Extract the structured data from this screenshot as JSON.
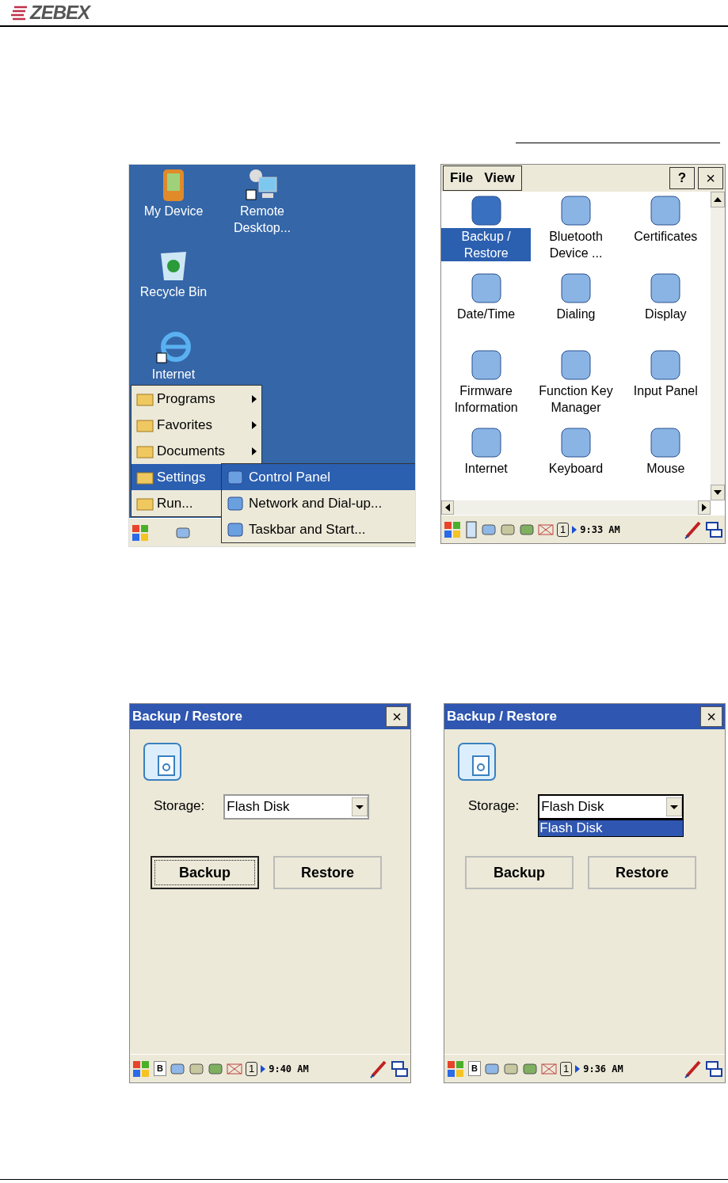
{
  "header": {
    "logo": "ZEBEX"
  },
  "desktop": {
    "icons": [
      {
        "label": "My Device",
        "kind": "device"
      },
      {
        "label": "Remote Desktop...",
        "kind": "remote"
      },
      {
        "label": "Recycle Bin",
        "kind": "bin"
      },
      {
        "label": "Internet",
        "kind": "globe"
      }
    ],
    "start_menu": [
      {
        "label": "Programs",
        "submenu": true,
        "selected": false
      },
      {
        "label": "Favorites",
        "submenu": true,
        "selected": false
      },
      {
        "label": "Documents",
        "submenu": true,
        "selected": false
      },
      {
        "label": "Settings",
        "submenu": true,
        "selected": true
      },
      {
        "label": "Run...",
        "selected": false
      }
    ],
    "submenu": [
      {
        "label": "Control Panel",
        "selected": true
      },
      {
        "label": "Network and Dial-up...",
        "selected": false
      },
      {
        "label": "Taskbar and Start...",
        "selected": false
      }
    ]
  },
  "control_panel": {
    "menu": [
      "File",
      "View"
    ],
    "help": "?",
    "close": "×",
    "items": [
      {
        "label": "Backup / Restore",
        "selected": true
      },
      {
        "label": "Bluetooth Device ...",
        "selected": false
      },
      {
        "label": "Certificates",
        "selected": false
      },
      {
        "label": "Date/Time",
        "selected": false
      },
      {
        "label": "Dialing",
        "selected": false
      },
      {
        "label": "Display",
        "selected": false
      },
      {
        "label": "Firmware Information",
        "selected": false
      },
      {
        "label": "Function Key Manager",
        "selected": false
      },
      {
        "label": "Input Panel",
        "selected": false
      },
      {
        "label": "Internet",
        "selected": false
      },
      {
        "label": "Keyboard",
        "selected": false
      },
      {
        "label": "Mouse",
        "selected": false
      }
    ],
    "taskbar": {
      "tray_number": "1",
      "time": "9:33 AM"
    }
  },
  "dialogs": [
    {
      "title": "Backup / Restore",
      "close": "×",
      "storage_label": "Storage:",
      "storage_value": "Flash Disk",
      "dropdown_open": false,
      "buttons": [
        {
          "label": "Backup",
          "focused": true
        },
        {
          "label": "Restore",
          "focused": false
        }
      ],
      "taskbar": {
        "tray_letter": "B",
        "tray_number": "1",
        "time": "9:40 AM"
      }
    },
    {
      "title": "Backup / Restore",
      "close": "×",
      "storage_label": "Storage:",
      "storage_value": "Flash Disk",
      "dropdown_open": true,
      "options": [
        {
          "label": "Flash Disk",
          "selected": true
        }
      ],
      "buttons": [
        {
          "label": "Backup",
          "focused": false
        },
        {
          "label": "Restore",
          "focused": false
        }
      ],
      "taskbar": {
        "tray_letter": "B",
        "tray_number": "1",
        "time": "9:36 AM"
      }
    }
  ]
}
